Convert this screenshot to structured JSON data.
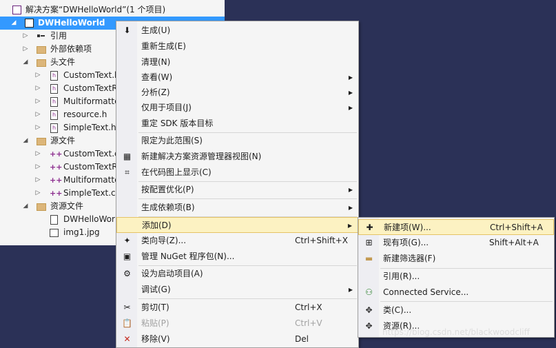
{
  "solution_explorer": {
    "solution_title": "解决方案“DWHelloWorld”(1 个项目)",
    "project_name": "DWHelloWorld",
    "nodes": [
      {
        "label": "引用"
      },
      {
        "label": "外部依赖项"
      },
      {
        "label": "头文件"
      },
      {
        "label": "CustomText.h"
      },
      {
        "label": "CustomTextR"
      },
      {
        "label": "Multiformatte"
      },
      {
        "label": "resource.h"
      },
      {
        "label": "SimpleText.h"
      },
      {
        "label": "源文件"
      },
      {
        "label": "CustomText.c"
      },
      {
        "label": "CustomTextR"
      },
      {
        "label": "Multiformatte"
      },
      {
        "label": "SimpleText.cp"
      },
      {
        "label": "资源文件"
      },
      {
        "label": "DWHelloWor"
      },
      {
        "label": "img1.jpg"
      }
    ]
  },
  "context_menu": {
    "items": [
      {
        "label": "生成(U)"
      },
      {
        "label": "重新生成(E)"
      },
      {
        "label": "清理(N)"
      },
      {
        "label": "查看(W)"
      },
      {
        "label": "分析(Z)"
      },
      {
        "label": "仅用于项目(J)"
      },
      {
        "label": "重定 SDK 版本目标"
      },
      {
        "label": "限定为此范围(S)"
      },
      {
        "label": "新建解决方案资源管理器视图(N)"
      },
      {
        "label": "在代码图上显示(C)"
      },
      {
        "label": "按配置优化(P)"
      },
      {
        "label": "生成依赖项(B)"
      },
      {
        "label": "添加(D)"
      },
      {
        "label": "类向导(Z)...",
        "shortcut": "Ctrl+Shift+X"
      },
      {
        "label": "管理 NuGet 程序包(N)..."
      },
      {
        "label": "设为启动项目(A)"
      },
      {
        "label": "调试(G)"
      },
      {
        "label": "剪切(T)",
        "shortcut": "Ctrl+X"
      },
      {
        "label": "粘贴(P)",
        "shortcut": "Ctrl+V"
      },
      {
        "label": "移除(V)",
        "shortcut": "Del"
      }
    ]
  },
  "add_submenu": {
    "items": [
      {
        "label": "新建项(W)...",
        "shortcut": "Ctrl+Shift+A"
      },
      {
        "label": "现有项(G)...",
        "shortcut": "Shift+Alt+A"
      },
      {
        "label": "新建筛选器(F)"
      },
      {
        "label": "引用(R)..."
      },
      {
        "label": "Connected Service..."
      },
      {
        "label": "类(C)..."
      },
      {
        "label": "资源(R)..."
      }
    ]
  },
  "watermark": "https://blog.csdn.net/blackwoodcliff",
  "colors": {
    "background": "#2b3157",
    "selection": "#3399ff",
    "highlight": "#fcf2c2",
    "highlight_border": "#e5c365"
  }
}
